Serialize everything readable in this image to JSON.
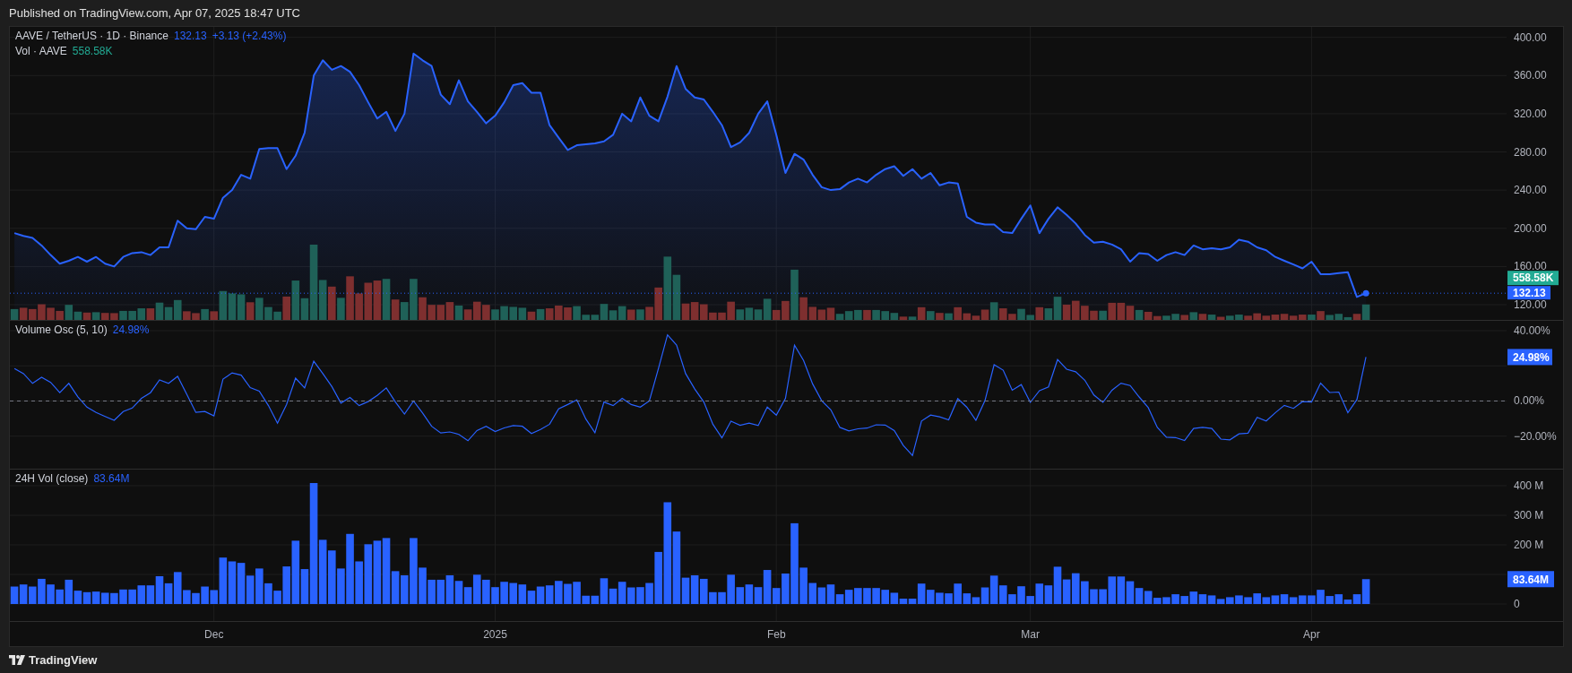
{
  "header": {
    "published": "Published on TradingView.com, Apr 07, 2025 18:47 UTC"
  },
  "price_pane": {
    "symbol": "AAVE / TetherUS · 1D · Binance",
    "last": "132.13",
    "change": "+3.13 (+2.43%)",
    "volume_label": "Vol · AAVE",
    "volume_value": "558.58K",
    "volume_badge": "558.58K",
    "price_badge": "132.13",
    "chart_data": {
      "type": "area",
      "grid": true,
      "ylim": [
        104,
        411
      ],
      "yticks": [
        {
          "value": 400,
          "label": "400.00"
        },
        {
          "value": 360,
          "label": "360.00"
        },
        {
          "value": 320,
          "label": "320.00"
        },
        {
          "value": 280,
          "label": "280.00"
        },
        {
          "value": 240,
          "label": "240.00"
        },
        {
          "value": 200,
          "label": "200.00"
        },
        {
          "value": 160,
          "label": "160.00"
        },
        {
          "value": 120,
          "label": "120.00"
        }
      ],
      "series": [
        {
          "color": "#2962ff",
          "values": [
            195,
            192,
            190,
            182,
            172,
            163,
            166,
            170,
            165,
            170,
            163,
            160,
            170,
            174,
            175,
            172,
            180,
            180,
            208,
            200,
            199,
            212,
            210,
            232,
            240,
            256,
            252,
            283,
            284,
            284,
            262,
            276,
            300,
            360,
            376,
            366,
            370,
            364,
            350,
            332,
            315,
            322,
            302,
            320,
            383,
            376,
            370,
            340,
            330,
            355,
            333,
            322,
            310,
            318,
            332,
            350,
            352,
            342,
            342,
            308,
            295,
            282,
            287,
            288,
            289,
            291,
            298,
            320,
            312,
            337,
            318,
            312,
            338,
            370,
            346,
            337,
            335,
            322,
            308,
            285,
            290,
            300,
            320,
            333,
            298,
            258,
            278,
            272,
            256,
            243,
            240,
            241,
            248,
            252,
            248,
            256,
            262,
            265,
            255,
            262,
            252,
            258,
            245,
            248,
            247,
            212,
            206,
            204,
            204,
            196,
            195,
            210,
            224,
            195,
            210,
            222,
            214,
            205,
            193,
            185,
            186,
            183,
            178,
            165,
            174,
            173,
            166,
            172,
            175,
            172,
            182,
            178,
            179,
            178,
            180,
            188,
            186,
            180,
            177,
            170,
            166,
            162,
            158,
            165,
            152,
            152,
            153,
            154,
            128,
            132,
            null,
            null,
            null,
            null,
            null,
            null,
            null,
            null,
            null,
            null,
            null,
            null,
            null,
            null,
            null
          ]
        }
      ]
    }
  },
  "volume_osc": {
    "value": "24.98%",
    "badge": "24.98%",
    "chart_data": {
      "type": "line",
      "grid": true,
      "ylim": [
        -38.5,
        45.6
      ],
      "yticks": [
        {
          "value": 40,
          "label": "40.00%"
        },
        {
          "value": 0,
          "label": "0.00%"
        },
        {
          "value": -20,
          "label": "−20.00%"
        }
      ],
      "series": [
        {
          "name": "Volume Osc (5, 10)",
          "color": "#2962ff",
          "values": [
            18.5,
            15.6,
            10,
            13.5,
            10.6,
            4.7,
            10,
            2.4,
            -3.5,
            -6.5,
            -8.8,
            -11,
            -6,
            -4,
            1.5,
            4.7,
            12,
            10,
            14,
            3.8,
            -6.5,
            -6,
            -8.5,
            12.4,
            16,
            14.7,
            7.6,
            5.6,
            -2.6,
            -12.6,
            -2,
            13,
            7.4,
            22.6,
            15.6,
            8.2,
            -1.2,
            2,
            -2.6,
            -0.3,
            3.2,
            7.4,
            -0.6,
            -7.4,
            0,
            -6.8,
            -14.4,
            -18.2,
            -17.6,
            -19,
            -22.6,
            -16.8,
            -14.4,
            -17.4,
            -15.3,
            -14,
            -14.4,
            -18.5,
            -16.2,
            -13.2,
            -4.4,
            -2,
            0.6,
            -10.3,
            -18,
            -0.6,
            -2.6,
            1.5,
            -2,
            -3.5,
            0,
            18.5,
            37.6,
            31.8,
            15.6,
            6.8,
            -0.6,
            -13.2,
            -21,
            -11.5,
            -13.8,
            -12.6,
            -14,
            -3.5,
            -8,
            1.5,
            31.8,
            23,
            9.7,
            0.2,
            -5,
            -15,
            -17,
            -15.8,
            -15.4,
            -13.5,
            -13.7,
            -16.8,
            -25.3,
            -31,
            -11.4,
            -8,
            -9,
            -10.7,
            1.3,
            -3.6,
            -11,
            0.2,
            20.6,
            17.5,
            6.1,
            9.3,
            -0.8,
            5.9,
            8,
            23.6,
            18.1,
            16.6,
            11.8,
            3.4,
            -0.8,
            6.1,
            10.1,
            8.8,
            2.3,
            -3.8,
            -15,
            -20.6,
            -20.8,
            -22.5,
            -15.6,
            -15,
            -15.6,
            -21.7,
            -22.1,
            -18.7,
            -18.3,
            -9.3,
            -11.4,
            -6.7,
            -2.5,
            -4.2,
            -0.4,
            -0.6,
            10.1,
            4.8,
            5.1,
            -6.7,
            0.8,
            25,
            null,
            null,
            null,
            null,
            null,
            null,
            null,
            null,
            null,
            null,
            null,
            null,
            null,
            null,
            null
          ]
        }
      ]
    }
  },
  "vol_24h": {
    "value": "83.64M",
    "badge": "83.64M",
    "chart_data": {
      "type": "bar",
      "grid": true,
      "ylim": [
        -57.6,
        454.5
      ],
      "yticks": [
        {
          "value": 400,
          "label": "400 M"
        },
        {
          "value": 300,
          "label": "300 M"
        },
        {
          "value": 200,
          "label": "200 M"
        },
        {
          "value": 0,
          "label": "0"
        }
      ],
      "series": [
        {
          "name": "24H Vol (close)",
          "color": "#2962ff",
          "values": [
            59,
            66,
            59,
            85,
            66,
            49,
            82,
            45,
            40,
            42,
            38,
            37,
            49,
            49,
            63,
            63,
            94,
            70,
            108,
            47,
            37,
            59,
            47,
            157,
            144,
            139,
            96,
            120,
            70,
            45,
            127,
            214,
            118,
            409,
            217,
            181,
            120,
            237,
            144,
            202,
            214,
            223,
            111,
            97,
            223,
            123,
            82,
            82,
            97,
            78,
            57,
            99,
            82,
            57,
            75,
            71,
            66,
            45,
            59,
            63,
            78,
            68,
            75,
            28,
            28,
            87,
            52,
            75,
            56,
            57,
            71,
            176,
            344,
            245,
            89,
            97,
            85,
            40,
            40,
            99,
            57,
            66,
            57,
            115,
            54,
            103,
            273,
            123,
            71,
            56,
            66,
            33,
            48,
            54,
            54,
            54,
            48,
            38,
            18,
            18,
            69,
            48,
            38,
            36,
            69,
            36,
            23,
            56,
            96,
            63,
            33,
            60,
            27,
            69,
            63,
            126,
            83,
            104,
            77,
            50,
            50,
            93,
            93,
            77,
            54,
            44,
            21,
            23,
            33,
            27,
            42,
            33,
            29,
            17,
            23,
            29,
            23,
            36,
            23,
            29,
            33,
            23,
            29,
            29,
            48,
            27,
            33,
            15,
            33,
            84,
            null,
            null,
            null,
            null,
            null,
            null,
            null,
            null,
            null,
            null,
            null,
            null,
            null,
            null,
            null
          ]
        }
      ]
    }
  },
  "time_axis": {
    "labels": [
      {
        "label": "Dec"
      },
      {
        "label": "2025"
      },
      {
        "label": "Feb"
      },
      {
        "label": "Mar"
      },
      {
        "label": "Apr"
      }
    ]
  },
  "footer": {
    "brand": "TradingView"
  }
}
